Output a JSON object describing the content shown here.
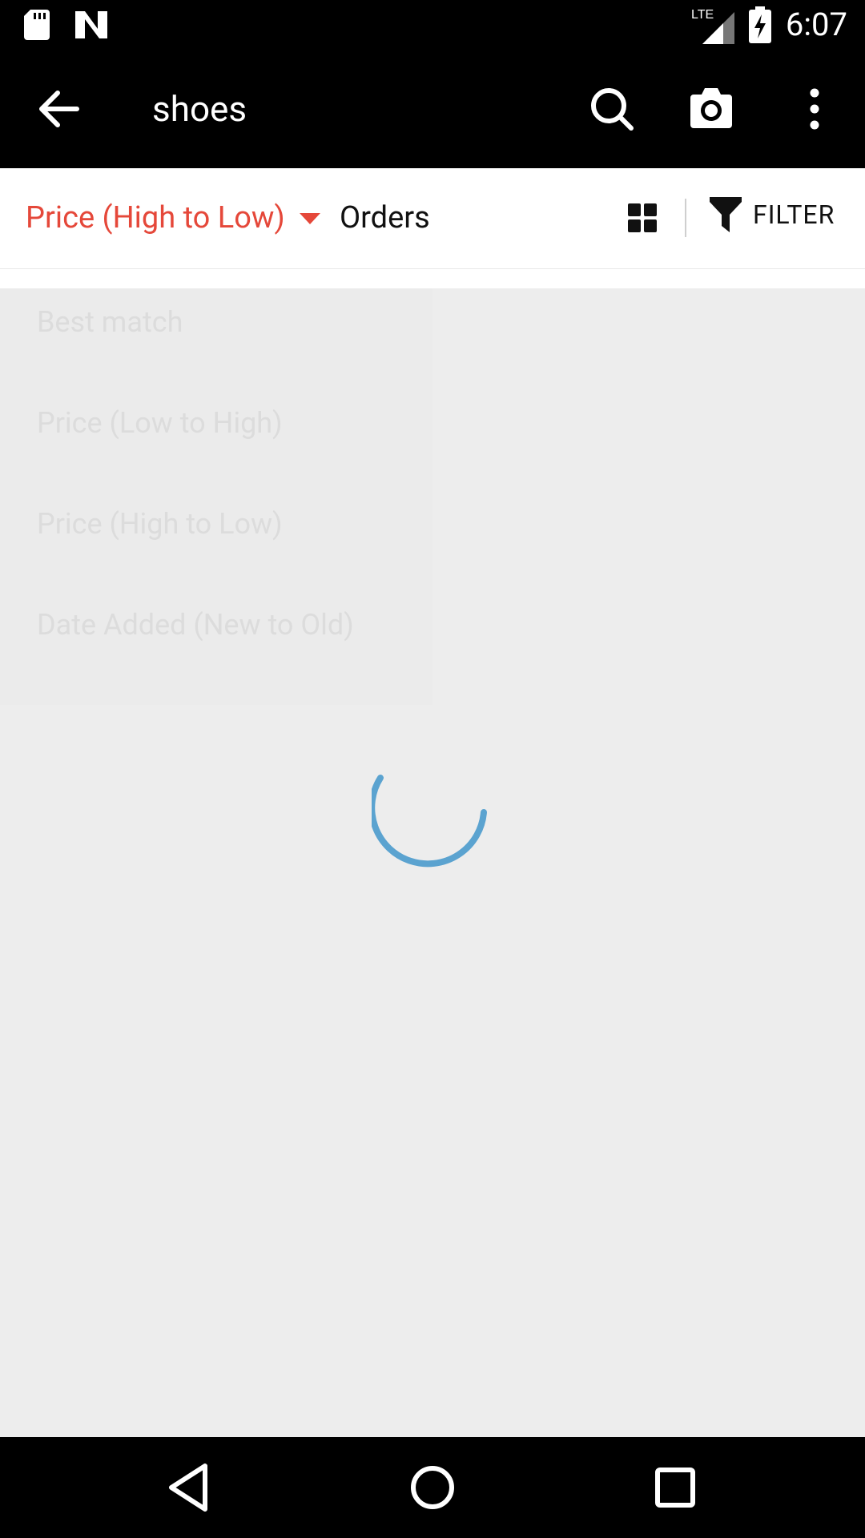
{
  "status_bar": {
    "time": "6:07",
    "network": "LTE"
  },
  "app_bar": {
    "query": "shoes"
  },
  "sort_bar": {
    "selected_sort": "Price (High to Low)",
    "orders_label": "Orders",
    "filter_label": "FILTER"
  },
  "dropdown": {
    "items": [
      "Best match",
      "Price (Low to High)",
      "Price (High to Low)",
      "Date Added (New to Old)"
    ]
  },
  "colors": {
    "accent": "#e5483a",
    "spinner": "#5ba3d0"
  }
}
